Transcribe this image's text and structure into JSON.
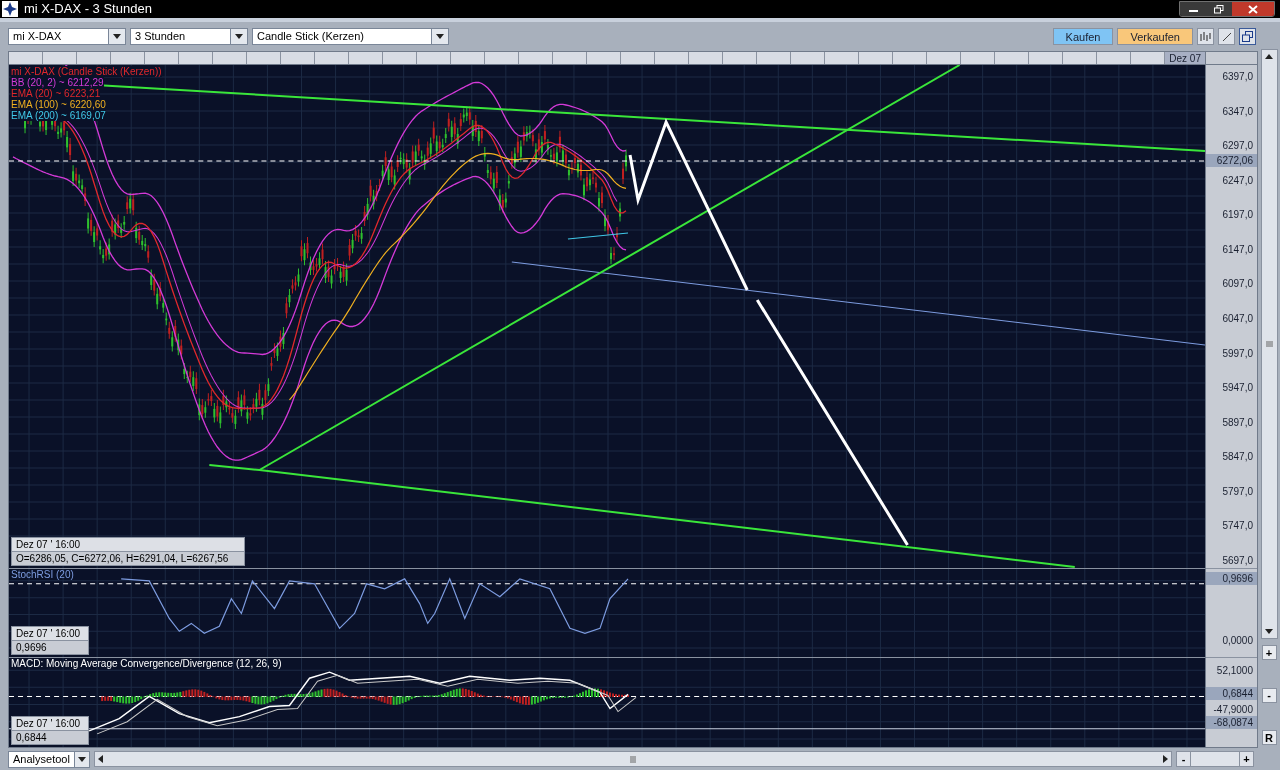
{
  "window": {
    "title": "mi X-DAX - 3 Stunden"
  },
  "toolbar": {
    "selects": [
      {
        "value": "mi X-DAX"
      },
      {
        "value": "3 Stunden"
      },
      {
        "value": "Candle Stick (Kerzen)"
      }
    ],
    "buttons": [
      {
        "label": "Kaufen",
        "color": "#7fc4f4"
      },
      {
        "label": "Verkaufen",
        "color": "#f9c77a"
      }
    ]
  },
  "time_ruler": {
    "label": "Dez 07"
  },
  "main_chart": {
    "legend": [
      {
        "text": "mi X-DAX (Candle Stick (Kerzen))",
        "color": "#e0282c"
      },
      {
        "text": "BB (20, 2) ~ 6212,29",
        "color": "#d43ad8"
      },
      {
        "text": "EMA (20) ~ 6223,21",
        "color": "#e0282c"
      },
      {
        "text": "EMA (100) ~ 6220,60",
        "color": "#f0b020"
      },
      {
        "text": "EMA (200) ~ 6169,07",
        "color": "#40c8e8"
      }
    ],
    "y_axis": [
      "6397,0",
      "6347,0",
      "6297,0",
      "6247,0",
      "6197,0",
      "6147,0",
      "6097,0",
      "6047,0",
      "5997,0",
      "5947,0",
      "5897,0",
      "5847,0",
      "5797,0",
      "5747,0",
      "5697,0"
    ],
    "current_value": "6272,06",
    "info_box": {
      "date": "Dez 07 ' 16:00",
      "values": "O=6286,05, C=6272,06, H=6291,04, L=6267,56"
    }
  },
  "stoch_panel": {
    "title": "StochRSI (20)",
    "current_value": "0,9696",
    "y_axis": [
      "0,0000"
    ],
    "info_box": {
      "date": "Dez 07 ' 16:00",
      "value": "0,9696"
    }
  },
  "macd_panel": {
    "title": "MACD: Moving Average Convergence/Divergence (12, 26, 9)",
    "y_axis": [
      "52,1000",
      "-47,9000"
    ],
    "current_value": "0,6844",
    "low_value": "-68,0874",
    "info_box": {
      "date": "Dez 07 ' 16:00",
      "value": "0,6844"
    }
  },
  "side_controls": [
    "+",
    "-",
    "R"
  ],
  "bottom_bar": {
    "select": "Analysetool",
    "zoom_out": "-",
    "zoom_in": "+"
  }
}
